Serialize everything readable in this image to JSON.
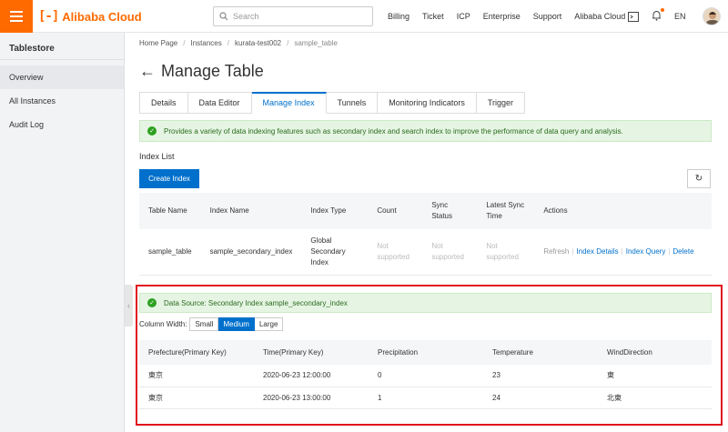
{
  "topbar": {
    "logo_mark": "[-]",
    "logo_text": "Alibaba Cloud",
    "search_placeholder": "Search",
    "nav": [
      "Billing",
      "Ticket",
      "ICP",
      "Enterprise",
      "Support",
      "Alibaba Cloud"
    ],
    "lang": "EN",
    "accent_color": "#ff6a00"
  },
  "sidebar": {
    "title": "Tablestore",
    "items": [
      {
        "label": "Overview"
      },
      {
        "label": "All Instances"
      },
      {
        "label": "Audit Log"
      }
    ]
  },
  "breadcrumb": [
    "Home Page",
    "Instances",
    "kurata-test002",
    "sample_table"
  ],
  "page": {
    "title": "Manage Table"
  },
  "tabs": [
    {
      "label": "Details"
    },
    {
      "label": "Data Editor"
    },
    {
      "label": "Manage Index",
      "active": true
    },
    {
      "label": "Tunnels"
    },
    {
      "label": "Monitoring Indicators"
    },
    {
      "label": "Trigger"
    }
  ],
  "notice": "Provides a variety of data indexing features such as secondary index and search index to improve the performance of data query and analysis.",
  "index_list": {
    "title": "Index List",
    "create_button": "Create Index",
    "headers": [
      "Table Name",
      "Index Name",
      "Index Type",
      "Count",
      "Sync Status",
      "Latest Sync Time",
      "Actions"
    ],
    "rows": [
      {
        "table_name": "sample_table",
        "index_name": "sample_secondary_index",
        "index_type": "Global Secondary Index",
        "count": "Not supported",
        "sync_status": "Not supported",
        "latest_sync_time": "Not supported",
        "actions": [
          "Refresh",
          "Index Details",
          "Index Query",
          "Delete"
        ]
      }
    ]
  },
  "data_source": {
    "notice": "Data Source: Secondary Index sample_secondary_index",
    "column_width_label": "Column Width:",
    "widths": [
      "Small",
      "Medium",
      "Large"
    ],
    "selected_width": "Medium",
    "headers": [
      "Prefecture(Primary Key)",
      "Time(Primary Key)",
      "Precipitation",
      "Temperature",
      "WindDirection"
    ],
    "rows": [
      [
        "東京",
        "2020-06-23 12:00:00",
        "0",
        "23",
        "東"
      ],
      [
        "東京",
        "2020-06-23 13:00:00",
        "1",
        "24",
        "北東"
      ]
    ]
  }
}
